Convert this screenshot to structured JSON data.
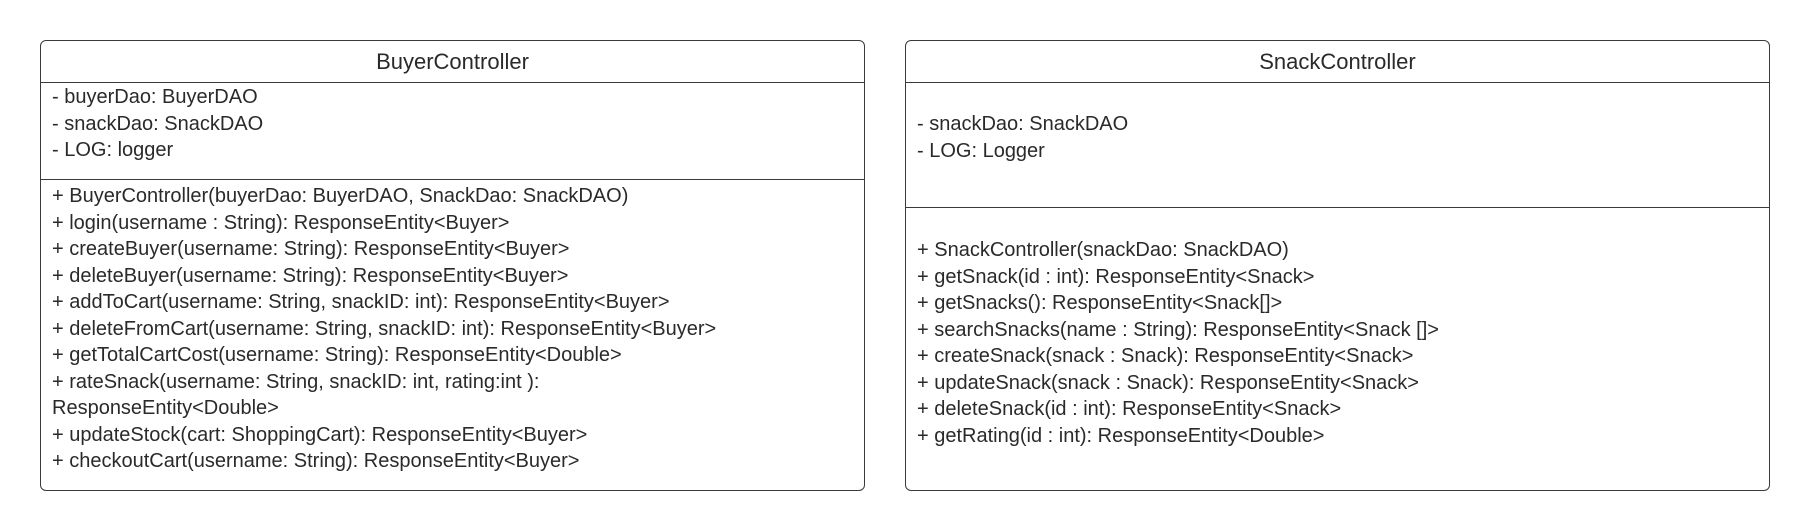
{
  "classes": [
    {
      "name": "BuyerController",
      "attributes": [
        "- buyerDao: BuyerDAO",
        "- snackDao: SnackDAO",
        "- LOG: logger"
      ],
      "operations": [
        "+ BuyerController(buyerDao: BuyerDAO, SnackDao: SnackDAO)",
        "+ login(username : String): ResponseEntity<Buyer>",
        "+ createBuyer(username: String): ResponseEntity<Buyer>",
        "+ deleteBuyer(username: String): ResponseEntity<Buyer>",
        "+ addToCart(username: String, snackID: int): ResponseEntity<Buyer>",
        "+ deleteFromCart(username: String, snackID: int): ResponseEntity<Buyer>",
        "+ getTotalCartCost(username: String): ResponseEntity<Double>",
        "+ rateSnack(username: String, snackID: int, rating:int ): ResponseEntity<Double>",
        "+ updateStock(cart: ShoppingCart): ResponseEntity<Buyer>",
        "+ checkoutCart(username: String): ResponseEntity<Buyer>"
      ]
    },
    {
      "name": "SnackController",
      "attributes": [
        "- snackDao: SnackDAO",
        "- LOG: Logger"
      ],
      "operations": [
        "+ SnackController(snackDao: SnackDAO)",
        "+ getSnack(id : int): ResponseEntity<Snack>",
        "+ getSnacks(): ResponseEntity<Snack[]>",
        "+ searchSnacks(name : String): ResponseEntity<Snack []>",
        "+ createSnack(snack : Snack): ResponseEntity<Snack>",
        "+ updateSnack(snack : Snack): ResponseEntity<Snack>",
        "+ deleteSnack(id : int): ResponseEntity<Snack>",
        "+ getRating(id : int): ResponseEntity<Double>"
      ]
    }
  ]
}
